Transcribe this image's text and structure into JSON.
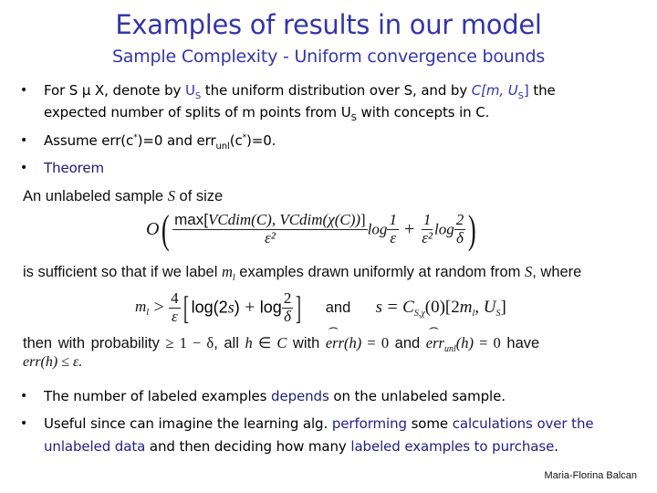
{
  "slide": {
    "title": "Examples of results in our model",
    "subtitle": "Sample Complexity - Uniform convergence bounds",
    "bullets": [
      {
        "line1_a": "For S µ X, denote by ",
        "line1_us": "U",
        "line1_us_sub": "S",
        "line1_b": " the uniform distribution over S, and by ",
        "line1_c": "C[m, U",
        "line1_c_sub": "S",
        "line1_c_end": "]",
        "line1_d": " the",
        "line2_a": "expected number of splits of m points from U",
        "line2_sub": "S",
        "line2_b": " with concepts in C."
      },
      {
        "a": "Assume err(c",
        "sup1": "*",
        "b": ")=0 and err",
        "sub": "unl",
        "c": "(c",
        "sup2": "*",
        "d": ")=0."
      },
      {
        "label": "Theorem"
      },
      {
        "a": "The number of labeled examples ",
        "hl": "depends",
        "b": " on the unlabeled sample."
      },
      {
        "line1_a": "Useful since can imagine the learning alg. ",
        "line1_hl1": "performing",
        "line1_b": " some ",
        "line1_hl2": "calculations over the",
        "line2_hl1": "unlabeled data",
        "line2_a": " and then deciding how many ",
        "line2_hl2": "labeled examples to purchase",
        "line2_b": "."
      }
    ],
    "theorem": {
      "intro_a": "An unlabeled sample ",
      "intro_S": "S",
      "intro_b": " of size",
      "formula1": {
        "O": "O",
        "num": "max[VCdim(C), VCdim(χ(C))]",
        "den": "ε²",
        "log1": "log",
        "f1_num": "1",
        "f1_den": "ε",
        "plus": "+",
        "f2_num": "1",
        "f2_den": "ε²",
        "log2": "log",
        "f3_num": "2",
        "f3_den": "δ"
      },
      "line2_a": "is sufficient so that if we label ",
      "line2_ml": "m",
      "line2_ml_sub": "l",
      "line2_b": " examples drawn uniformly at random from ",
      "line2_S": "S",
      "line2_c": ", where",
      "formula2": {
        "lhs": "m",
        "lhs_sub": "l",
        "gt": ">",
        "f_num": "4",
        "f_den": "ε",
        "log_a": "log(2",
        "s": "s",
        "log_a_end": ")",
        "plus": "+",
        "log_b": "log",
        "g_num": "2",
        "g_den": "δ",
        "and": "and",
        "s2": "s",
        "eq": "=",
        "C": "C",
        "C_sub": "S,χ",
        "rest": "(0)[2",
        "m": "m",
        "m_sub": "l",
        "comma": ", ",
        "U": "U",
        "U_sub": "S",
        "close": "]"
      },
      "line3_a": "then with probability ",
      "line3_ge": "≥ 1 − δ",
      "line3_b": ", all ",
      "line3_h": "h",
      "line3_in": " ∈ ",
      "line3_C": "C",
      "line3_c": " with ",
      "line3_err": "err",
      "line3_hh": "(h)",
      "line3_eq0": " = 0",
      "line3_d": " and ",
      "line3_err2": "err",
      "line3_err2_sub": "unl",
      "line3_hh2": "(h)",
      "line3_eq02": " = 0",
      "line3_e": " have",
      "line4": "err(h) ≤ ε."
    },
    "footer": "Maria-Florina Balcan"
  }
}
